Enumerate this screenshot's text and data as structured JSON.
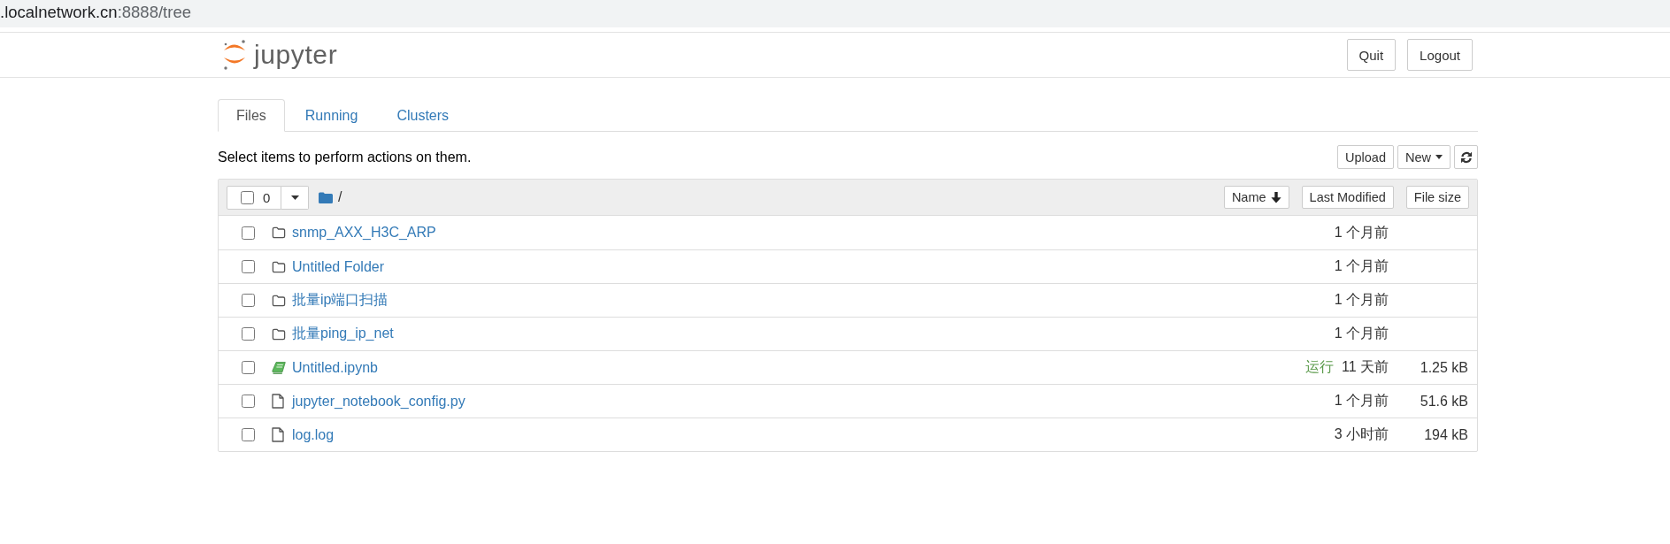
{
  "address_bar": {
    "host": ".localnetwork.cn",
    "path": ":8888/tree"
  },
  "header": {
    "logo_text": "jupyter",
    "buttons": [
      "Quit",
      "Logout"
    ]
  },
  "tabs": [
    {
      "label": "Files",
      "selected": true
    },
    {
      "label": "Running",
      "selected": false
    },
    {
      "label": "Clusters",
      "selected": false
    }
  ],
  "toolbar": {
    "hint": "Select items to perform actions on them.",
    "upload_label": "Upload",
    "new_label": "New"
  },
  "list_header": {
    "select_all_checked": false,
    "selected_count": "0",
    "path": "/",
    "sort_buttons": [
      {
        "label": "Name",
        "sorted": true
      },
      {
        "label": "Last Modified",
        "sorted": false
      },
      {
        "label": "File size",
        "sorted": false
      }
    ]
  },
  "items": [
    {
      "kind": "folder",
      "name": "snmp_AXX_H3C_ARP",
      "checked": false,
      "modified": "1 个月前"
    },
    {
      "kind": "folder",
      "name": "Untitled Folder",
      "checked": false,
      "modified": "1 个月前"
    },
    {
      "kind": "folder",
      "name": "批量ip端口扫描",
      "checked": false,
      "modified": "1 个月前"
    },
    {
      "kind": "folder",
      "name": "批量ping_ip_net",
      "checked": false,
      "modified": "1 个月前"
    },
    {
      "kind": "notebook",
      "name": "Untitled.ipynb",
      "checked": false,
      "status_label": "运行",
      "modified": "11 天前",
      "size": "1.25 kB"
    },
    {
      "kind": "file",
      "name": "jupyter_notebook_config.py",
      "checked": false,
      "modified": "1 个月前",
      "size": "51.6 kB"
    },
    {
      "kind": "file",
      "name": "log.log",
      "checked": false,
      "modified": "3 小时前",
      "size": "194 kB"
    }
  ]
}
